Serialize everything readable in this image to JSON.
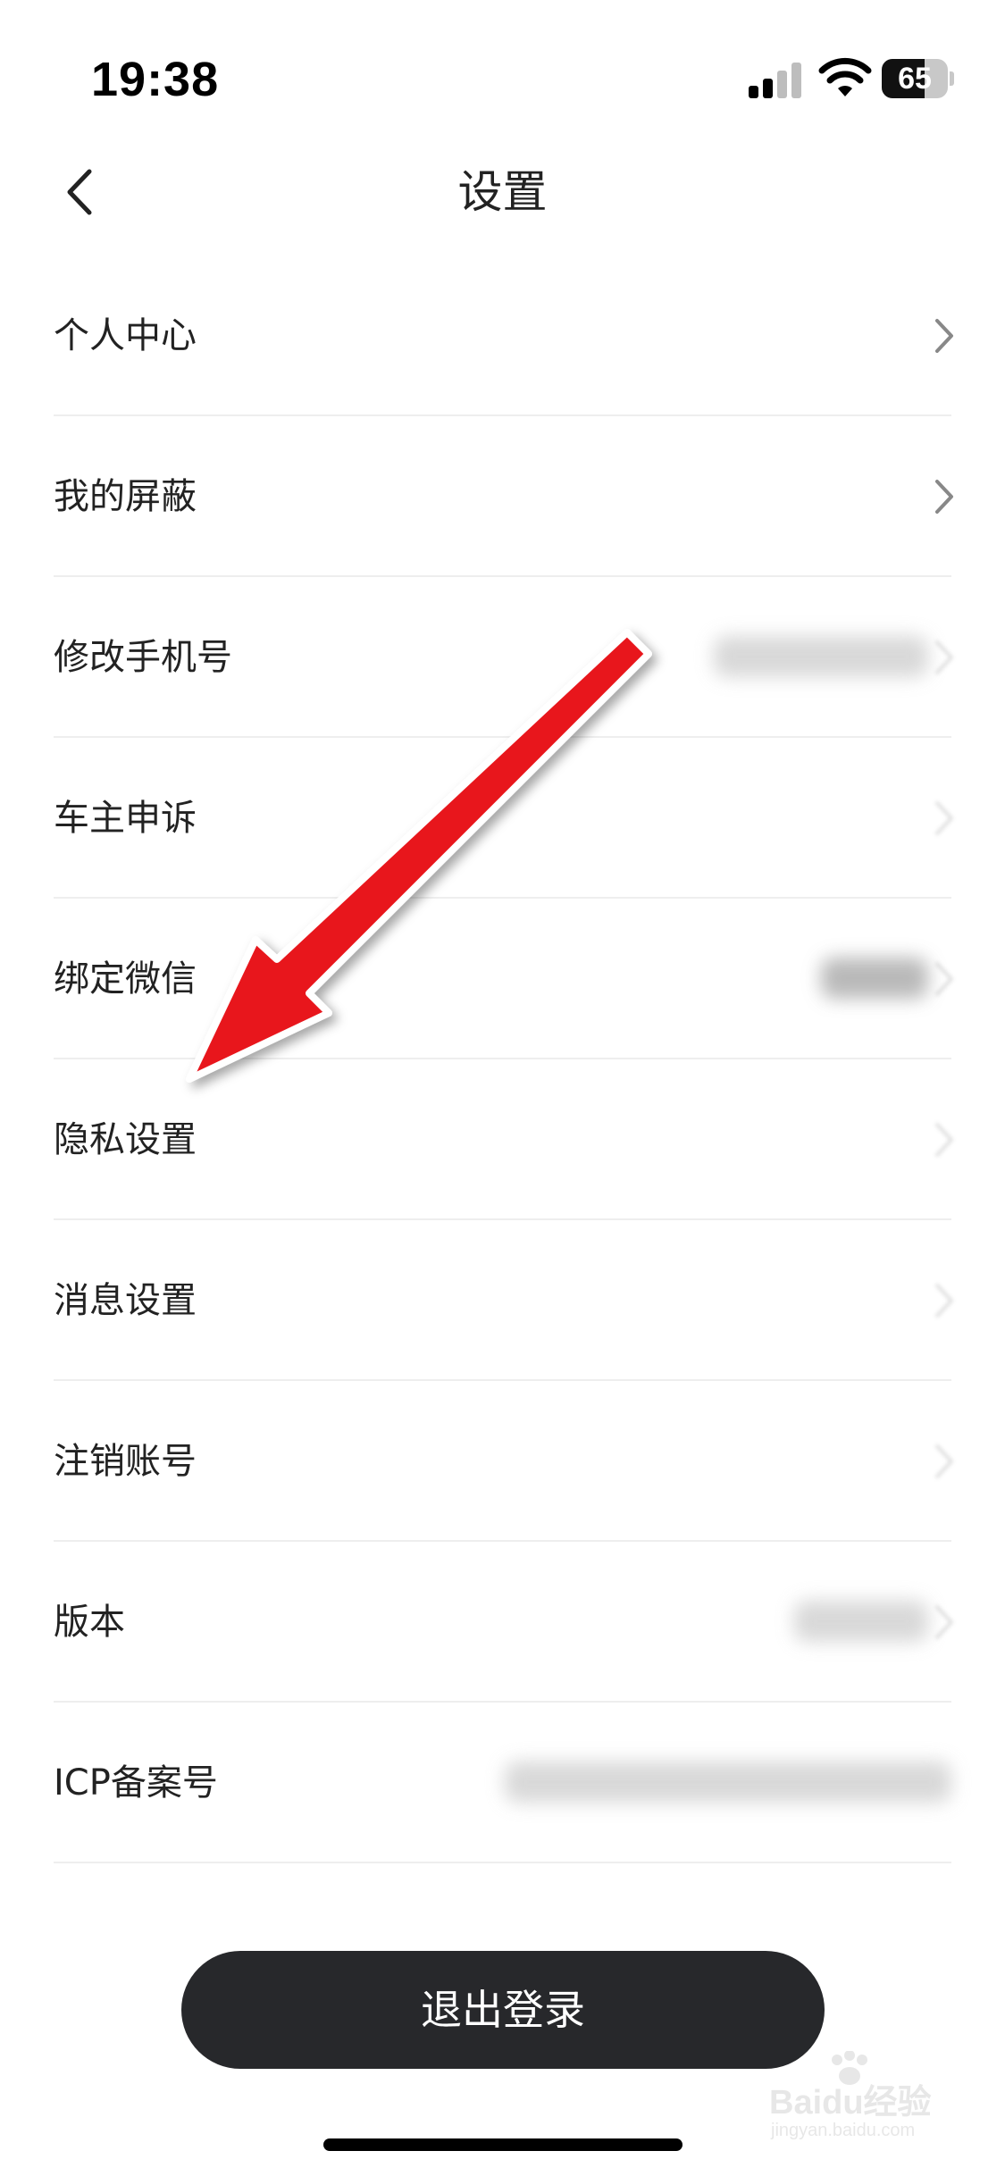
{
  "status_bar": {
    "time": "19:38",
    "battery_text": "65",
    "battery_level": 0.65,
    "icons": [
      "signal-icon",
      "wifi-icon",
      "battery-icon"
    ]
  },
  "nav": {
    "title": "设置",
    "back_icon": "chevron-left-icon"
  },
  "settings": {
    "items": [
      {
        "label": "个人中心"
      },
      {
        "label": "我的屏蔽"
      },
      {
        "label": "修改手机号"
      },
      {
        "label": "车主申诉"
      },
      {
        "label": "绑定微信"
      },
      {
        "label": "隐私设置"
      },
      {
        "label": "消息设置"
      },
      {
        "label": "注销账号"
      },
      {
        "label": "版本"
      },
      {
        "label": "ICP备案号"
      }
    ]
  },
  "logout": {
    "label": "退出登录"
  },
  "annotation": {
    "color": "#e8151b",
    "points_to": "隐私设置"
  },
  "watermark": {
    "text": "Baidu经验",
    "sub": "jingyan.baidu.com"
  },
  "colors": {
    "button_bg": "#27282b",
    "divider": "#eeeeee",
    "text": "#222222"
  }
}
